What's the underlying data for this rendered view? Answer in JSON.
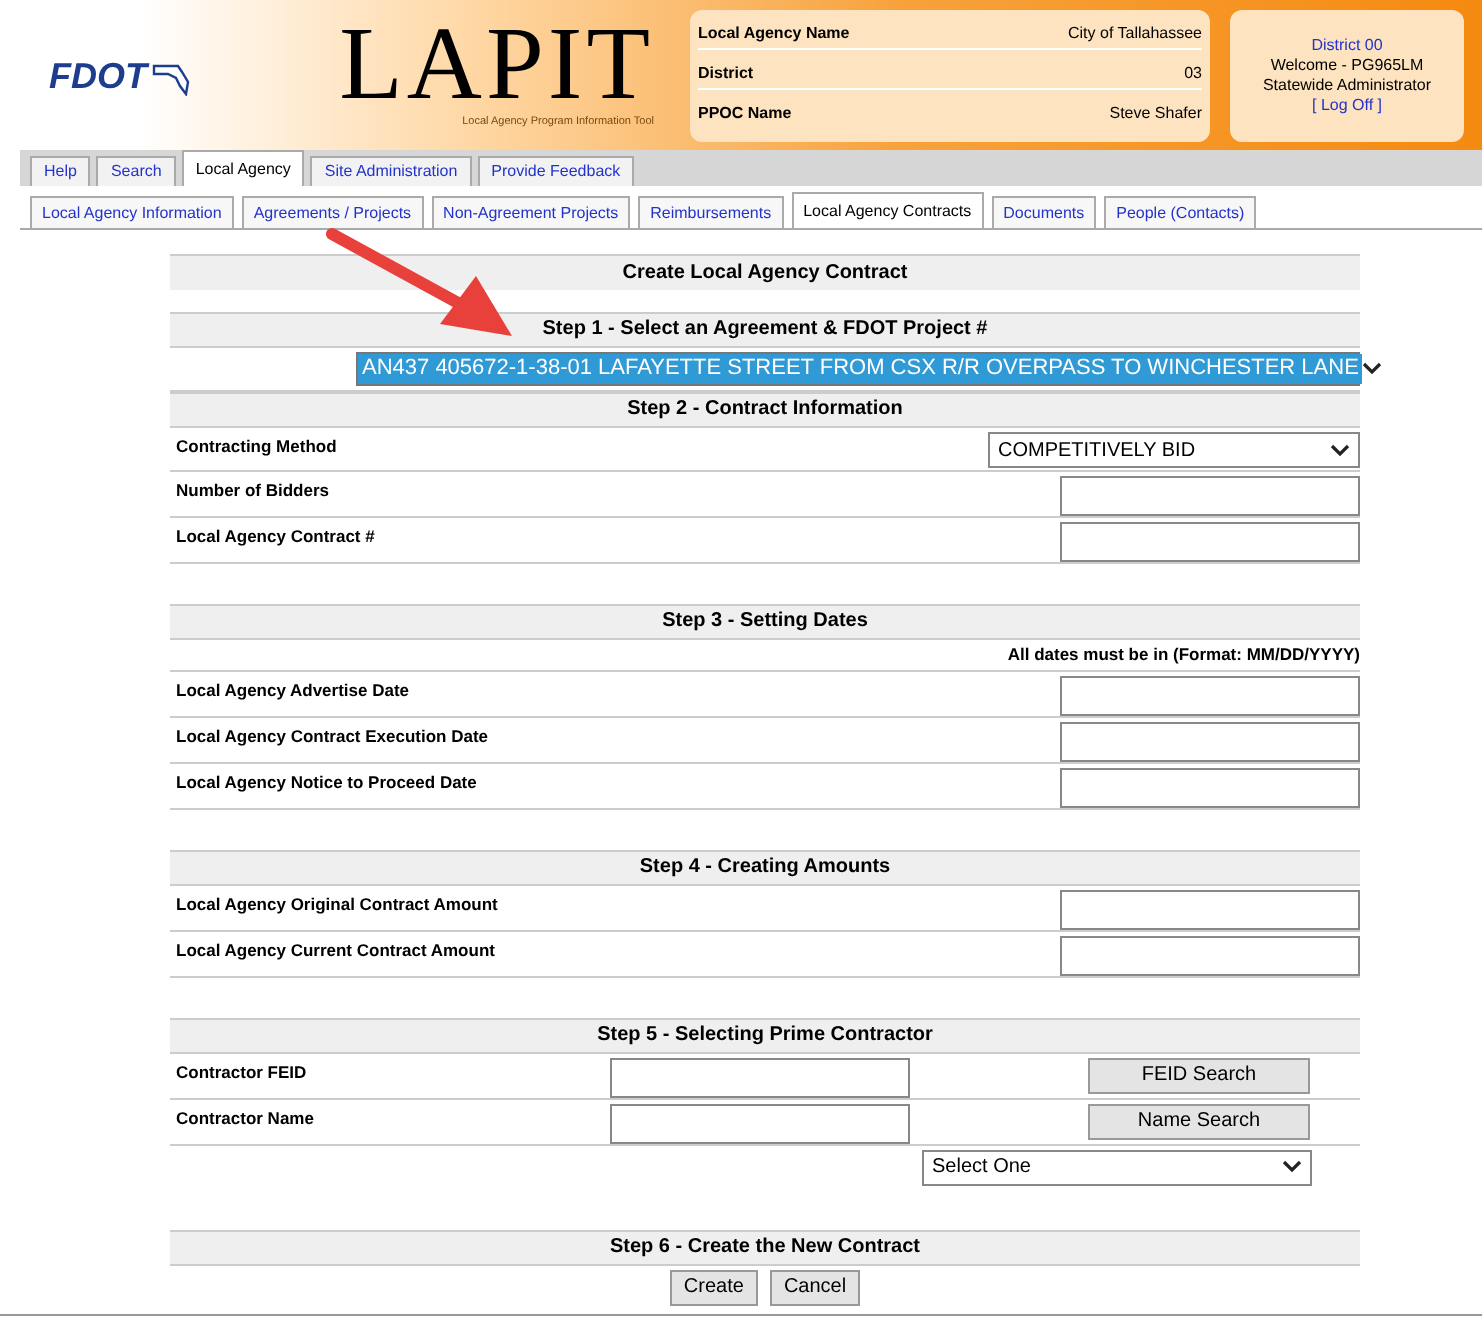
{
  "header": {
    "logo": "FDOT",
    "app_title": "LAPIT",
    "tagline": "Local Agency Program Information Tool",
    "info": [
      {
        "label": "Local Agency Name",
        "value": "City of Tallahassee"
      },
      {
        "label": "District",
        "value": "03"
      },
      {
        "label": "PPOC Name",
        "value": "Steve Shafer"
      }
    ],
    "user": {
      "district": "District 00",
      "welcome": "Welcome - PG965LM",
      "role": "Statewide Administrator",
      "logoff": "[ Log Off ]"
    }
  },
  "main_tabs": [
    {
      "label": "Help",
      "selected": false
    },
    {
      "label": "Search",
      "selected": false
    },
    {
      "label": "Local Agency",
      "selected": true
    },
    {
      "label": "Site Administration",
      "selected": false
    },
    {
      "label": "Provide Feedback",
      "selected": false
    }
  ],
  "sub_tabs": [
    {
      "label": "Local Agency Information",
      "selected": false
    },
    {
      "label": "Agreements / Projects",
      "selected": false
    },
    {
      "label": "Non-Agreement Projects",
      "selected": false
    },
    {
      "label": "Reimbursements",
      "selected": false
    },
    {
      "label": "Local Agency Contracts",
      "selected": true
    },
    {
      "label": "Documents",
      "selected": false
    },
    {
      "label": "People (Contacts)",
      "selected": false
    }
  ],
  "form": {
    "title": "Create Local Agency Contract",
    "sections": [
      {
        "heading": "Step 1 - Select an Agreement & FDOT Project #",
        "rows": [
          {
            "kind": "wide_select",
            "value": "AN437 405672-1-38-01 LAFAYETTE STREET FROM CSX R/R OVERPASS TO WINCHESTER LANE",
            "highlighted": true
          }
        ]
      },
      {
        "heading": "Step 2 - Contract Information",
        "rows": [
          {
            "kind": "select",
            "label": "Contracting Method",
            "value": "COMPETITIVELY BID"
          },
          {
            "kind": "input",
            "label": "Number of Bidders"
          },
          {
            "kind": "input",
            "label": "Local Agency Contract #"
          }
        ]
      },
      {
        "heading": "Step 3 - Setting Dates",
        "rows": [
          {
            "kind": "note",
            "text": "All dates must be in (Format: MM/DD/YYYY)"
          },
          {
            "kind": "input",
            "label": "Local Agency Advertise Date"
          },
          {
            "kind": "input",
            "label": "Local Agency Contract Execution Date"
          },
          {
            "kind": "input",
            "label": "Local Agency Notice to Proceed Date"
          }
        ]
      },
      {
        "heading": "Step 4 - Creating Amounts",
        "rows": [
          {
            "kind": "input",
            "label": "Local Agency Original Contract Amount"
          },
          {
            "kind": "input",
            "label": "Local Agency Current Contract Amount"
          }
        ]
      },
      {
        "heading": "Step 5 - Selecting Prime Contractor",
        "rows": [
          {
            "kind": "search",
            "label": "Contractor FEID",
            "button": "FEID Search"
          },
          {
            "kind": "search",
            "label": "Contractor Name",
            "button": "Name Search"
          },
          {
            "kind": "mid_select",
            "value": "Select One"
          }
        ]
      },
      {
        "heading": "Step 6 - Create the New Contract",
        "rows": [
          {
            "kind": "buttons",
            "buttons": [
              "Create",
              "Cancel"
            ]
          }
        ]
      }
    ]
  }
}
